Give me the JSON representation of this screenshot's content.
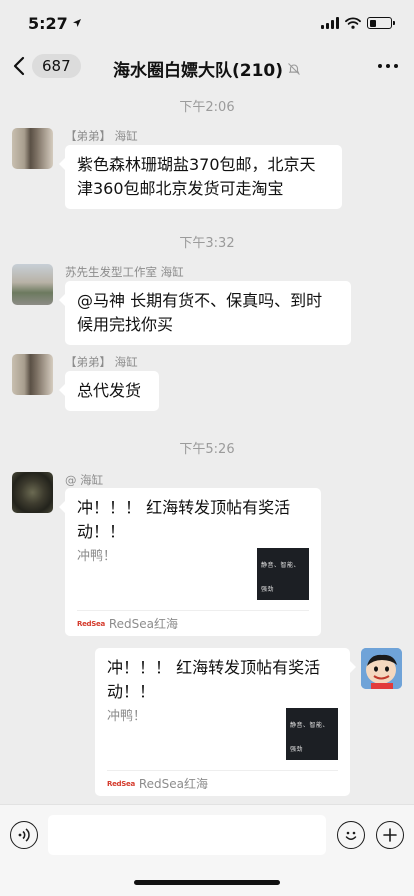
{
  "status_bar": {
    "time": "5:27",
    "location_icon": "location-arrow-icon",
    "battery_level": 0.3
  },
  "nav": {
    "unread_count": "687",
    "title": "海水圈白嫖大队(210)",
    "back_icon": "chevron-left-icon",
    "mute_icon": "bell-slash-icon",
    "more_icon": "more-dots-icon"
  },
  "messages": [
    {
      "type": "timestamp",
      "text": "下午2:06"
    },
    {
      "type": "text",
      "sender": "【弟弟】 海缸",
      "lines": [
        "紫色森林珊瑚盐370包邮，北京天",
        "津360包邮北京发货可走淘宝"
      ]
    },
    {
      "type": "timestamp",
      "text": "下午3:32"
    },
    {
      "type": "text",
      "sender": "苏先生发型工作室 海缸",
      "lines": [
        "@马神 长期有货不、保真吗、到时",
        "候用完找你买"
      ]
    },
    {
      "type": "text",
      "sender": "【弟弟】 海缸",
      "lines": [
        "总代发货"
      ]
    },
    {
      "type": "timestamp",
      "text": "下午5:26"
    },
    {
      "type": "card",
      "sender": "@ 海缸",
      "title_lines": [
        "冲！！！ 红海转发顶帖有奖活",
        "动！！"
      ],
      "desc": "冲鸭！",
      "thumb_text": "静音、智能、强劲",
      "source": "RedSea红海",
      "source_logo": "RedSea"
    },
    {
      "type": "card",
      "outgoing": true,
      "title_lines": [
        "冲！！！ 红海转发顶帖有奖活",
        "动！！"
      ],
      "desc": "冲鸭！",
      "thumb_text": "静音、智能、强劲",
      "source": "RedSea红海",
      "source_logo": "RedSea"
    }
  ],
  "input_bar": {
    "voice_icon": "voice-icon",
    "emoji_icon": "emoji-icon",
    "plus_icon": "plus-icon",
    "placeholder": ""
  }
}
